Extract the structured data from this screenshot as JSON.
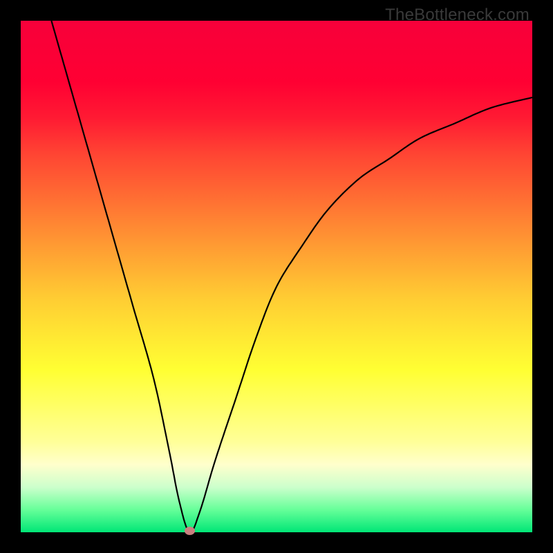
{
  "watermark": "TheBottleneck.com",
  "chart_data": {
    "type": "line",
    "title": "",
    "xlabel": "",
    "ylabel": "",
    "xlim": [
      0,
      100
    ],
    "ylim": [
      0,
      100
    ],
    "grid": false,
    "series": [
      {
        "name": "bottleneck-curve",
        "x": [
          6,
          10,
          14,
          18,
          22,
          26,
          29,
          31,
          33,
          35,
          38,
          42,
          46,
          50,
          55,
          60,
          66,
          72,
          78,
          85,
          92,
          100
        ],
        "values": [
          100,
          86,
          72,
          58,
          44,
          30,
          16,
          6,
          0,
          4,
          14,
          26,
          38,
          48,
          56,
          63,
          69,
          73,
          77,
          80,
          83,
          85
        ]
      }
    ],
    "annotations": [
      {
        "type": "marker",
        "x": 33,
        "y": 0,
        "name": "optimal-point",
        "color": "#c98080"
      }
    ],
    "background_gradient": {
      "stops": [
        {
          "pos": 0,
          "color": "#ff0033"
        },
        {
          "pos": 50,
          "color": "#ffcc33"
        },
        {
          "pos": 80,
          "color": "#ffff99"
        },
        {
          "pos": 100,
          "color": "#00e676"
        }
      ]
    }
  }
}
